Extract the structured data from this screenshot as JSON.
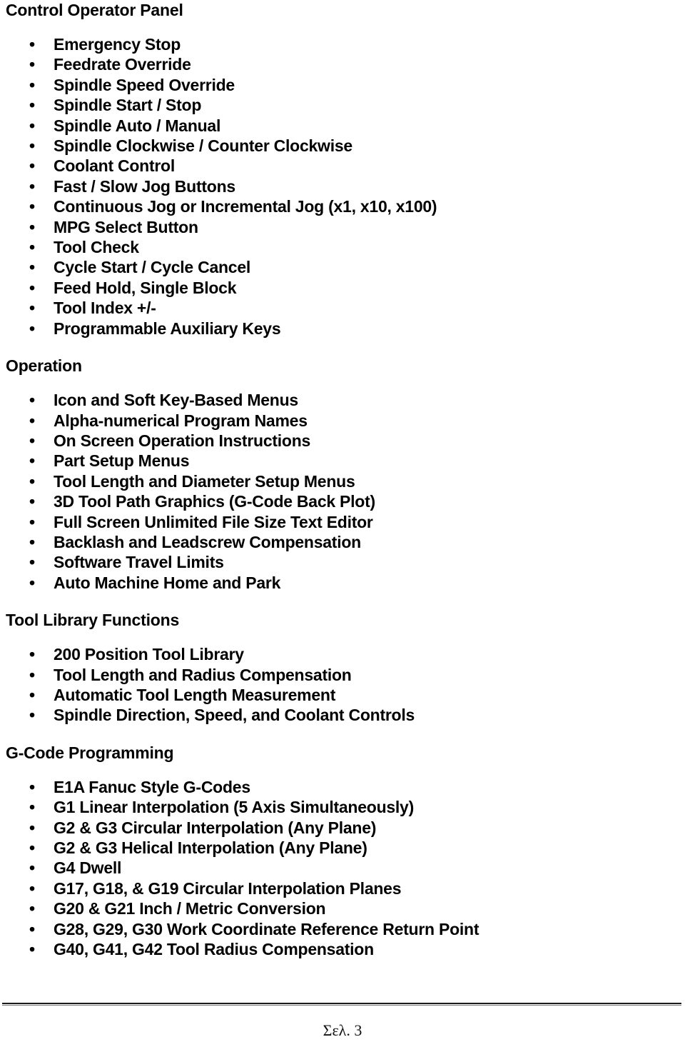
{
  "document": {
    "title": "Control Operator Panel",
    "footer_page_label": "Σελ. 3",
    "bullet_glyph": "•",
    "text_color": "#000000",
    "rule_color": "#1a1a1a"
  },
  "sections": [
    {
      "heading": "Control Operator Panel",
      "items": [
        "Emergency Stop",
        "Feedrate Override",
        "Spindle Speed Override",
        "Spindle Start / Stop",
        "Spindle Auto / Manual",
        "Spindle Clockwise / Counter Clockwise",
        "Coolant Control",
        "Fast / Slow Jog Buttons",
        "Continuous Jog or Incremental Jog (x1, x10, x100)",
        "MPG Select Button",
        "Tool Check",
        "Cycle Start / Cycle Cancel",
        "Feed Hold, Single Block",
        "Tool Index +/-",
        "Programmable Auxiliary Keys"
      ]
    },
    {
      "heading": "Operation",
      "items": [
        "Icon and Soft Key-Based Menus",
        "Alpha-numerical Program Names",
        "On Screen Operation Instructions",
        "Part Setup Menus",
        "Tool Length and Diameter Setup Menus",
        "3D Tool Path Graphics (G-Code Back Plot)",
        "Full Screen Unlimited File Size Text Editor",
        "Backlash and Leadscrew Compensation",
        "Software Travel Limits",
        "Auto Machine Home and Park"
      ]
    },
    {
      "heading": "Tool Library Functions",
      "items": [
        "200 Position Tool Library",
        "Tool Length and Radius Compensation",
        "Automatic Tool Length Measurement",
        "Spindle Direction, Speed, and Coolant Controls"
      ]
    },
    {
      "heading": "G-Code Programming",
      "items": [
        "E1A Fanuc Style G-Codes",
        "G1 Linear Interpolation (5 Axis Simultaneously)",
        "G2 & G3 Circular Interpolation (Any Plane)",
        "G2 & G3 Helical Interpolation (Any Plane)",
        "G4 Dwell",
        "G17, G18, & G19 Circular Interpolation Planes",
        "G20 & G21 Inch / Metric Conversion",
        "G28, G29, G30 Work Coordinate Reference Return Point",
        "G40, G41, G42 Tool Radius Compensation"
      ]
    }
  ]
}
